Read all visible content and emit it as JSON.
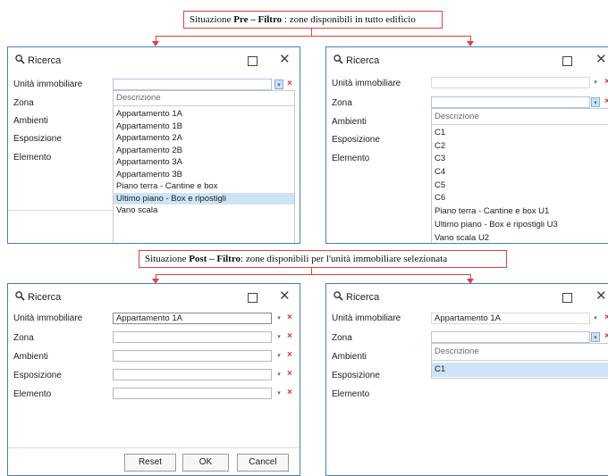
{
  "captions": {
    "pre": {
      "prefix": "Situazione ",
      "bold": "Pre – Filtro",
      "suffix": " : zone disponibili in tutto edificio"
    },
    "post": {
      "prefix": "Situazione ",
      "bold": "Post – Filtro",
      "suffix": ": zone disponibili per l'unità immobiliare selezionata"
    }
  },
  "dialog": {
    "title": "Ricerca",
    "maximize_glyph": "",
    "close_glyph": "✕",
    "fields": [
      "Unità immobiliare",
      "Zona",
      "Ambienti",
      "Esposizione",
      "Elemento"
    ],
    "clear_glyph": "×",
    "drop_glyph": "▾",
    "buttons": {
      "reset": "Reset",
      "ok": "OK",
      "cancel": "Cancel"
    }
  },
  "w1": {
    "list_header": "Descrizione",
    "items": [
      "Appartamento 1A",
      "Appartamento 1B",
      "Appartamento 2A",
      "Appartamento 2B",
      "Appartamento 3A",
      "Appartamento 3B",
      "Piano terra - Cantine e box",
      "Ultimo piano - Box e ripostigli",
      "Vano scala"
    ],
    "selected_index": 7
  },
  "w2": {
    "list_header": "Descrizione",
    "items": [
      "C1",
      "C2",
      "C3",
      "C4",
      "C5",
      "C6",
      "Piano terra - Cantine e box U1",
      "Ultimo piano - Box e ripostigli U3",
      "Vano scala U2"
    ]
  },
  "w3": {
    "unita_value": "Appartamento 1A"
  },
  "w4": {
    "unita_value": "Appartamento 1A",
    "list_header": "Descrizione",
    "items": [
      "C1"
    ],
    "selected_index": 0
  },
  "colors": {
    "accent_border": "#4a7fb5",
    "selection": "#cde4f7",
    "clear_red": "#dd3333",
    "caption_border": "#e04040"
  }
}
